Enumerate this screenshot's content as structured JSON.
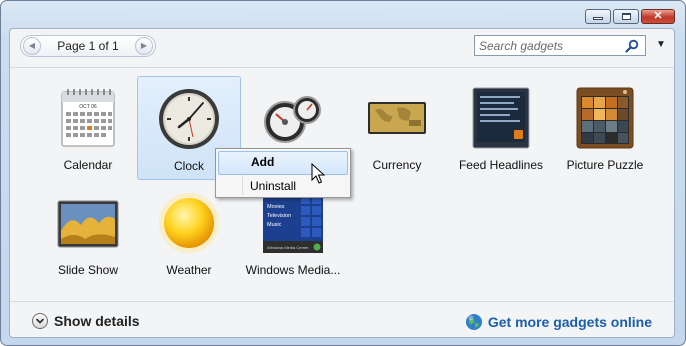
{
  "window": {
    "minimize_label": "Minimize",
    "maximize_label": "Maximize",
    "close_label": "Close"
  },
  "toolbar": {
    "page_text": "Page 1 of 1",
    "search_placeholder": "Search gadgets"
  },
  "gadgets": [
    {
      "name": "Calendar",
      "icon": "calendar-icon"
    },
    {
      "name": "Clock",
      "icon": "clock-icon",
      "selected": true
    },
    {
      "name": "",
      "icon": "cpu-meter-icon"
    },
    {
      "name": "Currency",
      "icon": "currency-icon"
    },
    {
      "name": "Feed Headlines",
      "icon": "feed-headlines-icon"
    },
    {
      "name": "Picture Puzzle",
      "icon": "picture-puzzle-icon"
    },
    {
      "name": "Slide Show",
      "icon": "slide-show-icon"
    },
    {
      "name": "Weather",
      "icon": "weather-icon"
    },
    {
      "name": "Windows Media...",
      "icon": "windows-media-center-icon"
    }
  ],
  "calendar_icon_text": {
    "month": "OCT 06"
  },
  "media_center_icon_text": {
    "items": [
      "Movies",
      "Television",
      "Music"
    ],
    "footer": "Windows Media Center"
  },
  "context_menu": {
    "items": [
      "Add",
      "Uninstall"
    ]
  },
  "footer": {
    "show_details": "Show details",
    "get_more": "Get more gadgets online"
  },
  "colors": {
    "link": "#1c5fa8",
    "selection": "#cfe3f8",
    "close_button": "#c0392b"
  }
}
